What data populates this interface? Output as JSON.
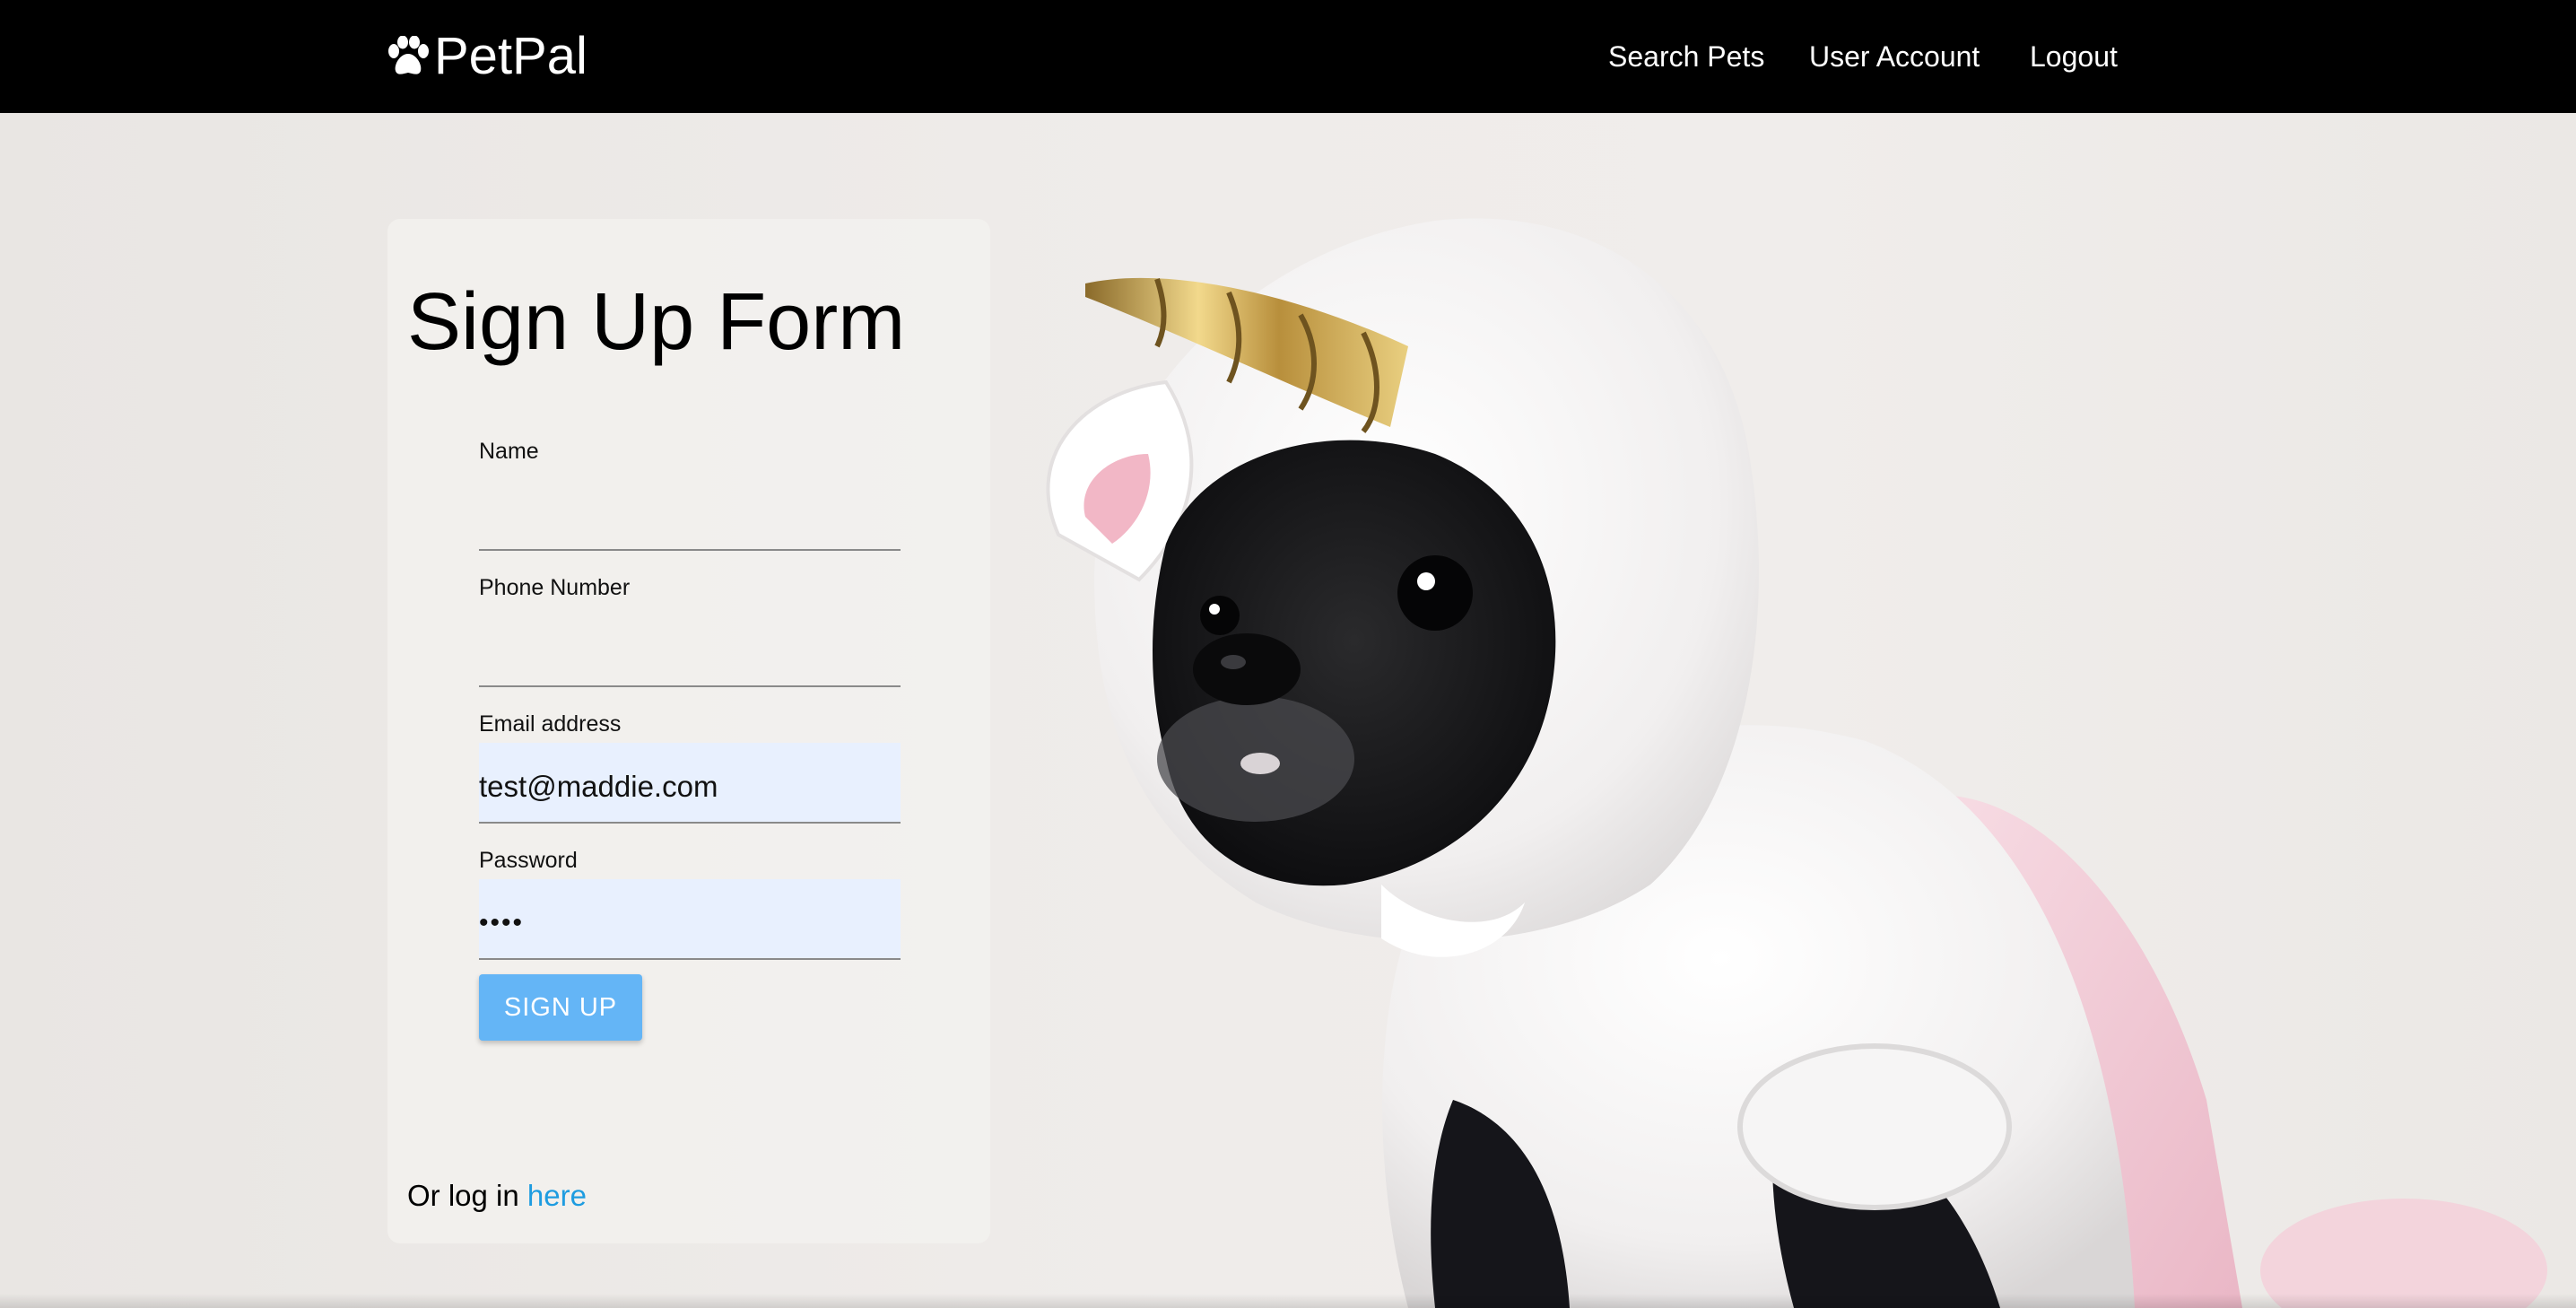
{
  "navbar": {
    "brand_text": "PetPal",
    "brand_icon": "paw-icon",
    "links": {
      "search_pets": "Search Pets",
      "user_account": "User Account",
      "logout": "Logout"
    },
    "background_color": "#000000"
  },
  "form": {
    "title": "Sign Up Form",
    "fields": {
      "name": {
        "label": "Name",
        "value": ""
      },
      "phone": {
        "label": "Phone Number",
        "value": ""
      },
      "email": {
        "label": "Email address",
        "value": "test@maddie.com"
      },
      "password": {
        "label": "Password",
        "value": "••••"
      }
    },
    "submit_label": "SIGN UP",
    "login_prefix": "Or log in ",
    "login_link": "here"
  },
  "colors": {
    "button": "#64b5f6",
    "link": "#1e9ce0",
    "autofill_bg": "#e8f0fe"
  }
}
